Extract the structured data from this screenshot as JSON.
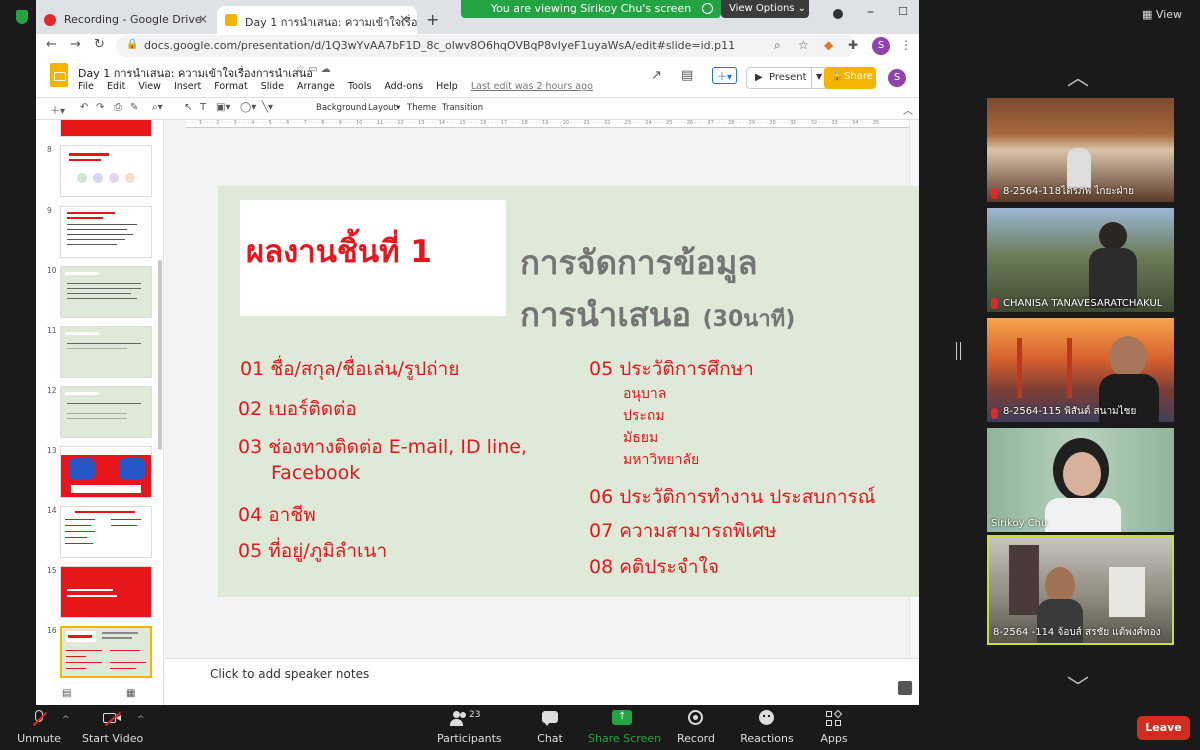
{
  "browser": {
    "tabs": [
      {
        "label": "Recording - Google Drive",
        "active": false
      },
      {
        "label": "Day 1 การนำเสนอ: ความเข้าใจเรื่อง",
        "active": true
      }
    ],
    "url": "docs.google.com/presentation/d/1Q3wYvAA7bF1D_8c_olwv8O6hqOVBqP8vIyeF1uyaWsA/edit#slide=id.p11"
  },
  "share_banner": {
    "text": "You are viewing Sirikoy Chu's screen",
    "options_label": "View Options"
  },
  "slides_app": {
    "doc_title": "Day 1 การนำเสนอ: ความเข้าใจเรื่องการนำเสนอ",
    "menu": [
      "File",
      "Edit",
      "View",
      "Insert",
      "Format",
      "Slide",
      "Arrange",
      "Tools",
      "Add-ons",
      "Help"
    ],
    "last_edit": "Last edit was 2 hours ago",
    "present_label": "Present",
    "share_label": "Share",
    "avatar_letter": "S",
    "toolbar": {
      "background": "Background",
      "layout": "Layout",
      "theme": "Theme",
      "transition": "Transition"
    },
    "speaker_notes_placeholder": "Click to add speaker notes"
  },
  "filmstrip": {
    "thumbs": [
      {
        "num": "",
        "style": "red",
        "top": 0
      },
      {
        "num": "8",
        "style": "white"
      },
      {
        "num": "9",
        "style": "white"
      },
      {
        "num": "10",
        "style": "green"
      },
      {
        "num": "11",
        "style": "green"
      },
      {
        "num": "12",
        "style": "green"
      },
      {
        "num": "13",
        "style": "blue"
      },
      {
        "num": "14",
        "style": "white"
      },
      {
        "num": "15",
        "style": "red"
      },
      {
        "num": "16",
        "style": "selected"
      }
    ]
  },
  "slide": {
    "title_red": "ผลงานชิ้นที่ 1",
    "title_gray_line1": "การจัดการข้อมูล",
    "title_gray_line2": "การนำเสนอ",
    "title_gray_duration": "(30นาที)",
    "left_items": [
      "01 ชื่อ/สกุล/ชื่อเล่น/รูปถ่าย",
      "02 เบอร์ติดต่อ",
      "03 ช่องทางติดต่อ E-mail, ID line,",
      "Facebook",
      "04  อาชีพ",
      "05  ที่อยู่/ภูมิลำเนา"
    ],
    "right_heading": "05 ประวัติการศึกษา",
    "education_levels": [
      "อนุบาล",
      "ประถม",
      "มัธยม",
      "มหาวิทยาลัย"
    ],
    "right_items": [
      "06 ประวัติการทำงาน ประสบการณ์",
      "07 ความสามารถพิเศษ",
      "08 คติประจำใจ"
    ]
  },
  "zoom": {
    "view_label": "View",
    "participants_count": "23",
    "toolbar": [
      {
        "label": "Unmute",
        "icon": "mic-muted-icon"
      },
      {
        "label": "Start Video",
        "icon": "video-off-icon"
      },
      {
        "label": "Participants",
        "icon": "participants-icon"
      },
      {
        "label": "Chat",
        "icon": "chat-icon"
      },
      {
        "label": "Share Screen",
        "icon": "share-screen-icon"
      },
      {
        "label": "Record",
        "icon": "record-icon"
      },
      {
        "label": "Reactions",
        "icon": "reactions-icon"
      },
      {
        "label": "Apps",
        "icon": "apps-icon"
      }
    ],
    "leave_label": "Leave",
    "participants": [
      {
        "name": "8-2564-118ไตรภพ ไกยะฝ่าย",
        "muted": true
      },
      {
        "name": "CHANISA TANAVESARATCHAKUL",
        "muted": true
      },
      {
        "name": "8-2564-115 พิสันต์ สนามไชย",
        "muted": true
      },
      {
        "name": "Sirikoy Chu",
        "muted": false
      },
      {
        "name": "8-2564 -114 จ้อบส์ สรชัย แต้พงศ์ทอง",
        "muted": false,
        "active_speaker": true
      }
    ],
    "colors": {
      "accent_green": "#23a442",
      "leave_red": "#d32b1d",
      "highlight": "#c7df3a"
    }
  }
}
